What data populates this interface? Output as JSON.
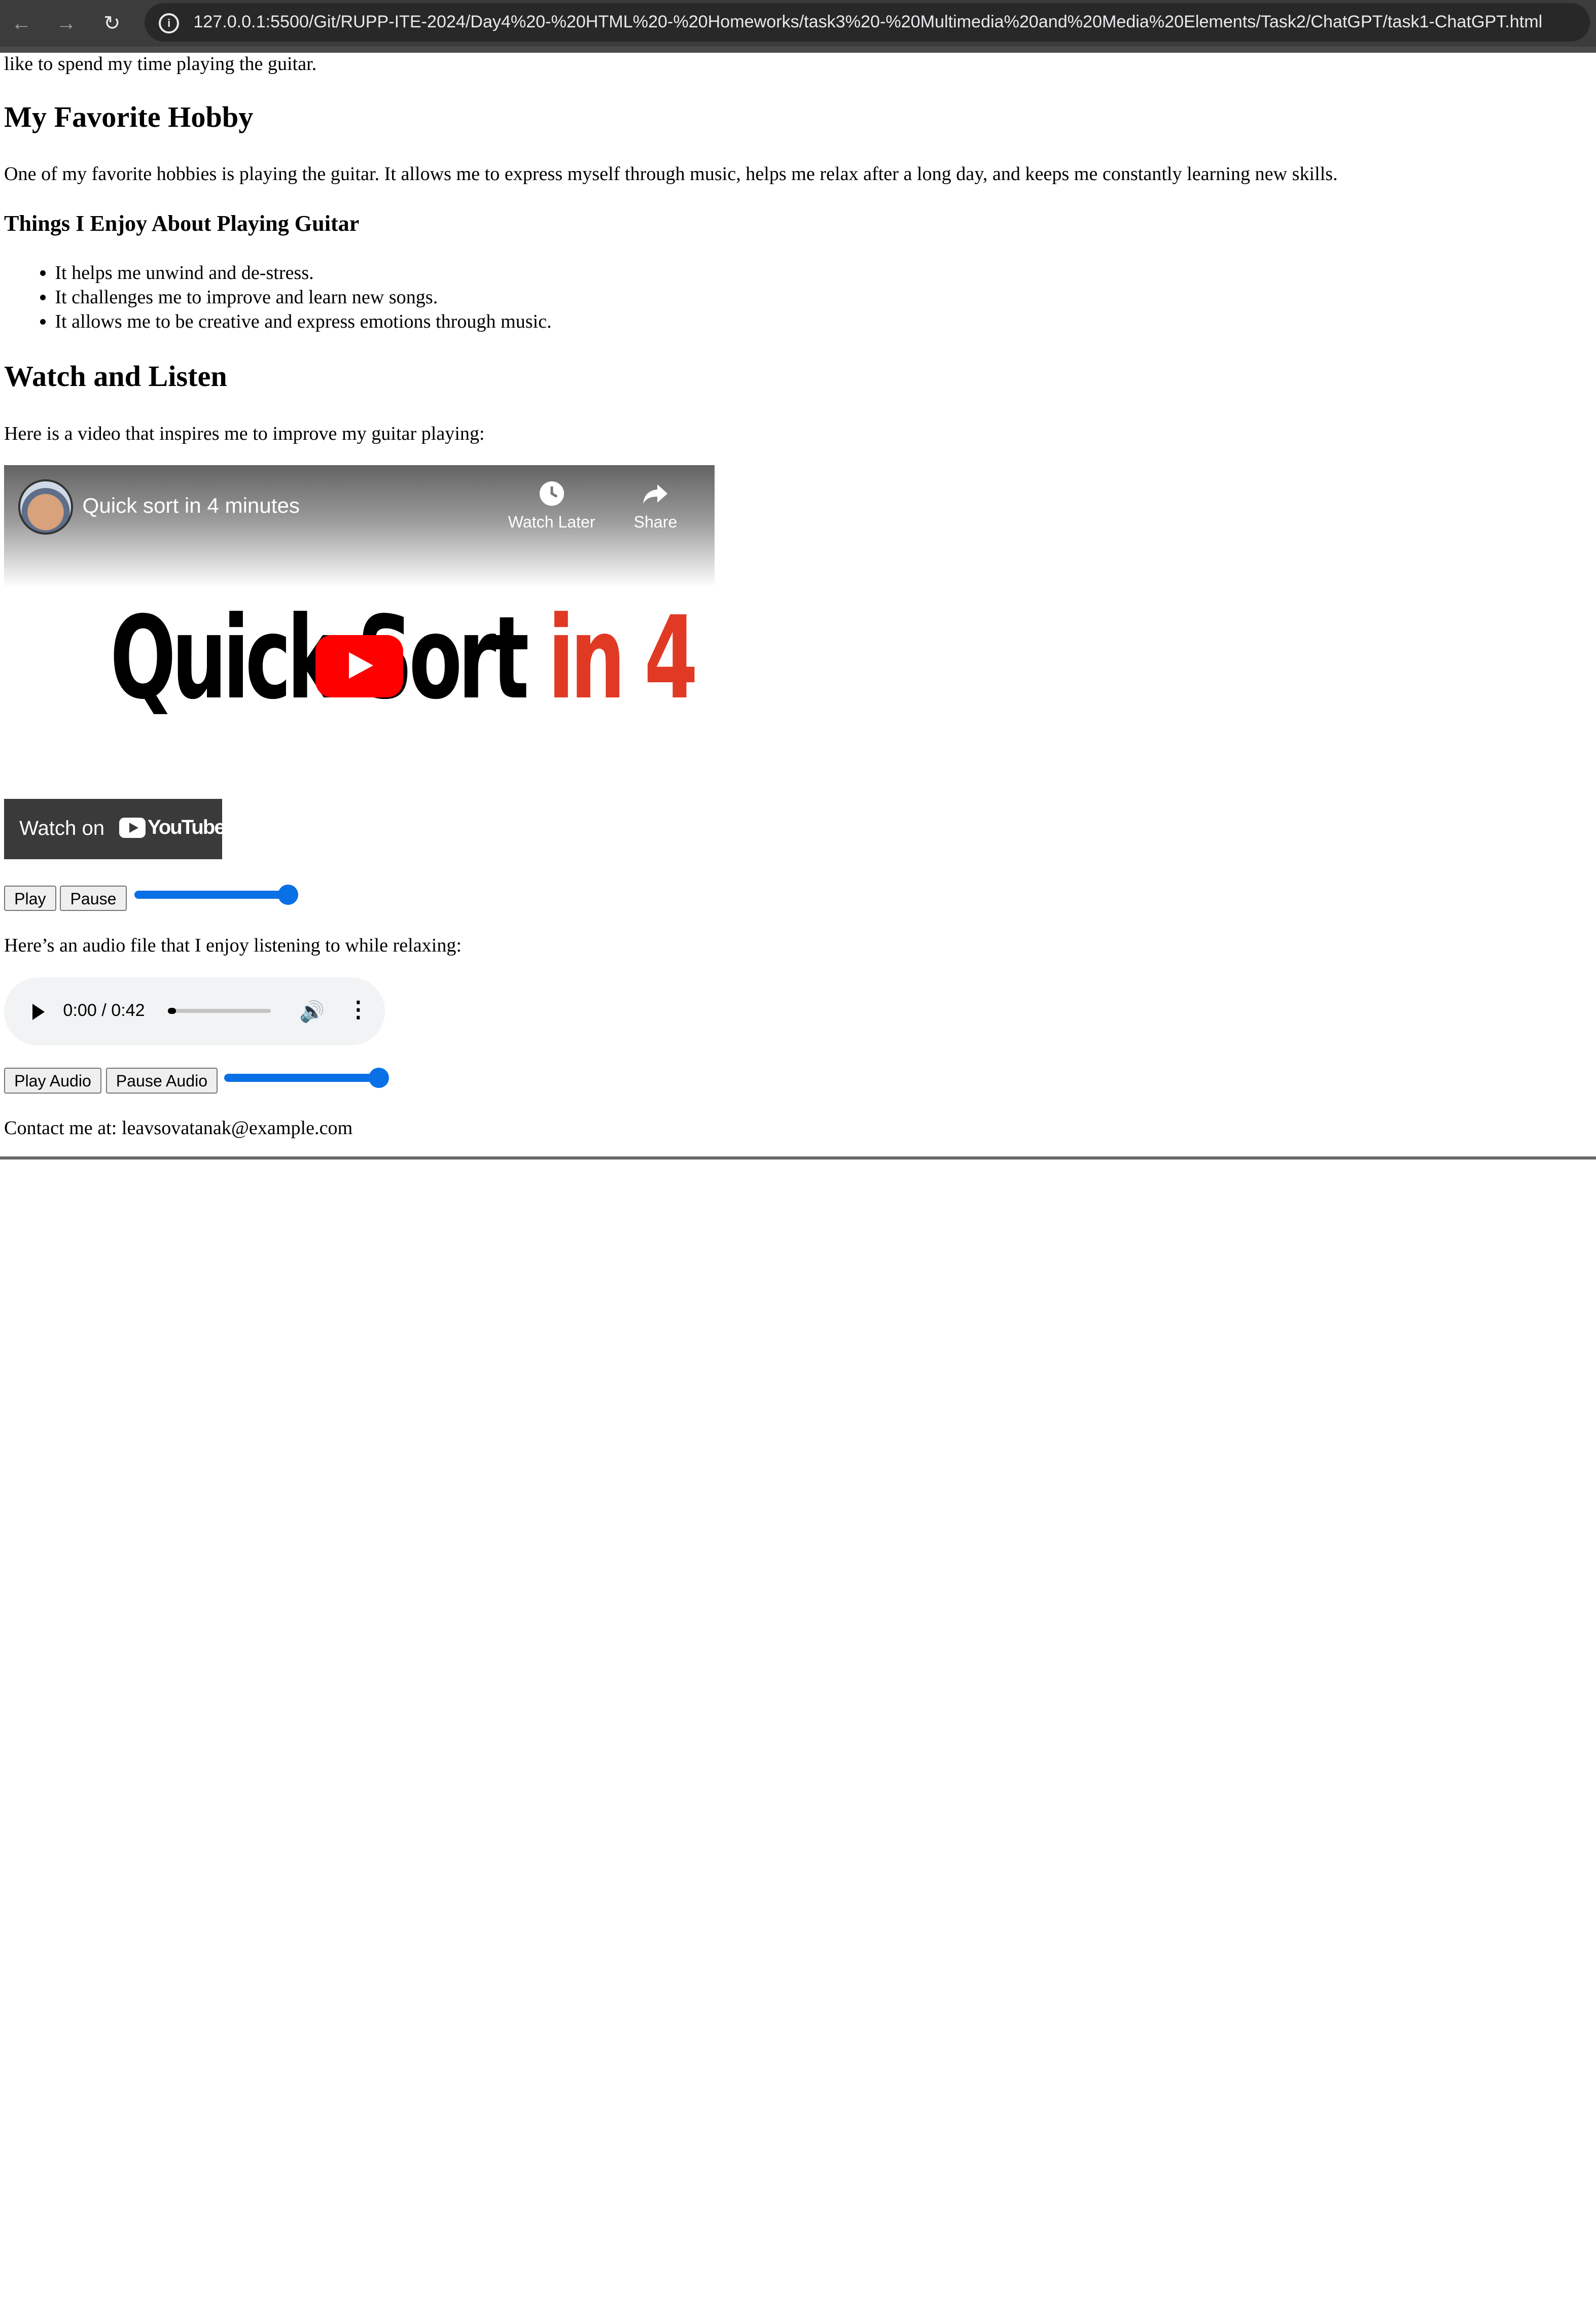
{
  "browser": {
    "back_icon": "arrow-left-icon",
    "forward_icon": "arrow-right-icon",
    "reload_icon": "reload-icon",
    "info_icon": "info-icon",
    "url": "127.0.0.1:5500/Git/RUPP-ITE-2024/Day4%20-%20HTML%20-%20Homeworks/task3%20-%20Multimedia%20and%20Media%20Elements/Task2/ChatGPT/task1-ChatGPT.html"
  },
  "content": {
    "intro_tail": "like to spend my time playing the guitar.",
    "hobby_heading": "My Favorite Hobby",
    "hobby_text": "One of my favorite hobbies is playing the guitar. It allows me to express myself through music, helps me relax after a long day, and keeps me constantly learning new skills.",
    "enjoy_heading": "Things I Enjoy About Playing Guitar",
    "enjoy_items": [
      "It helps me unwind and de-stress.",
      "It challenges me to improve and learn new songs.",
      "It allows me to be creative and express emotions through music."
    ],
    "watch_heading": "Watch and Listen",
    "video_intro": "Here is a video that inspires me to improve my guitar playing:",
    "audio_intro": "Here’s an audio file that I enjoy listening to while relaxing:",
    "contact": "Contact me at: leavsovatanak@example.com"
  },
  "video": {
    "title": "Quick sort in 4 minutes",
    "watch_later_label": "Watch Later",
    "share_label": "Share",
    "thumbnail_text_black": "Quick Sort",
    "thumbnail_text_red": " in 4",
    "watch_on_label": "Watch on",
    "youtube_label": "YouTube",
    "play_label": "Play",
    "pause_label": "Pause",
    "volume_level": 1.0
  },
  "audio": {
    "time": "0:00 / 0:42",
    "progress": 0.0,
    "play_label": "Play Audio",
    "pause_label": "Pause Audio",
    "volume_level": 1.0
  },
  "colors": {
    "accent_blue": "#0a70e6",
    "youtube_red": "#ff0000",
    "thumb_red": "#e03a25"
  }
}
